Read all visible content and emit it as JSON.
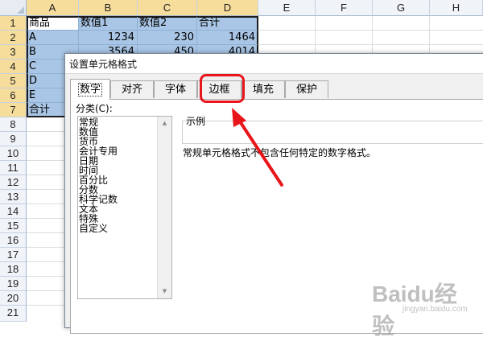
{
  "sheet": {
    "columns": [
      "A",
      "B",
      "C",
      "D",
      "E",
      "F",
      "G",
      "H"
    ],
    "rows": [
      "1",
      "2",
      "3",
      "4",
      "5",
      "6",
      "7",
      "8",
      "9",
      "10",
      "11",
      "12",
      "13",
      "14",
      "15",
      "16",
      "17",
      "18",
      "19",
      "20",
      "21"
    ],
    "cells": {
      "a1": "商品",
      "b1": "数值1",
      "c1": "数值2",
      "d1": "合计",
      "a2": "A",
      "b2": "1234",
      "c2": "230",
      "d2": "1464",
      "a3": "B",
      "b3": "3564",
      "c3": "450",
      "d3": "4014",
      "a4": "C",
      "a5": "D",
      "a6": "E",
      "a7": "合计"
    }
  },
  "dialog": {
    "title": "设置单元格格式",
    "tabs": [
      "数字",
      "对齐",
      "字体",
      "边框",
      "填充",
      "保护"
    ],
    "active_tab": "数字",
    "category_label": "分类(C):",
    "categories": [
      "常规",
      "数值",
      "货币",
      "会计专用",
      "日期",
      "时间",
      "百分比",
      "分数",
      "科学记数",
      "文本",
      "特殊",
      "自定义"
    ],
    "sample_label": "示例",
    "description": "常规单元格格式不包含任何特定的数字格式。"
  },
  "annotation": {
    "color": "#e8161b"
  },
  "watermark": {
    "logo": "Baidu经验",
    "url": "jingyan.baidu.com"
  }
}
